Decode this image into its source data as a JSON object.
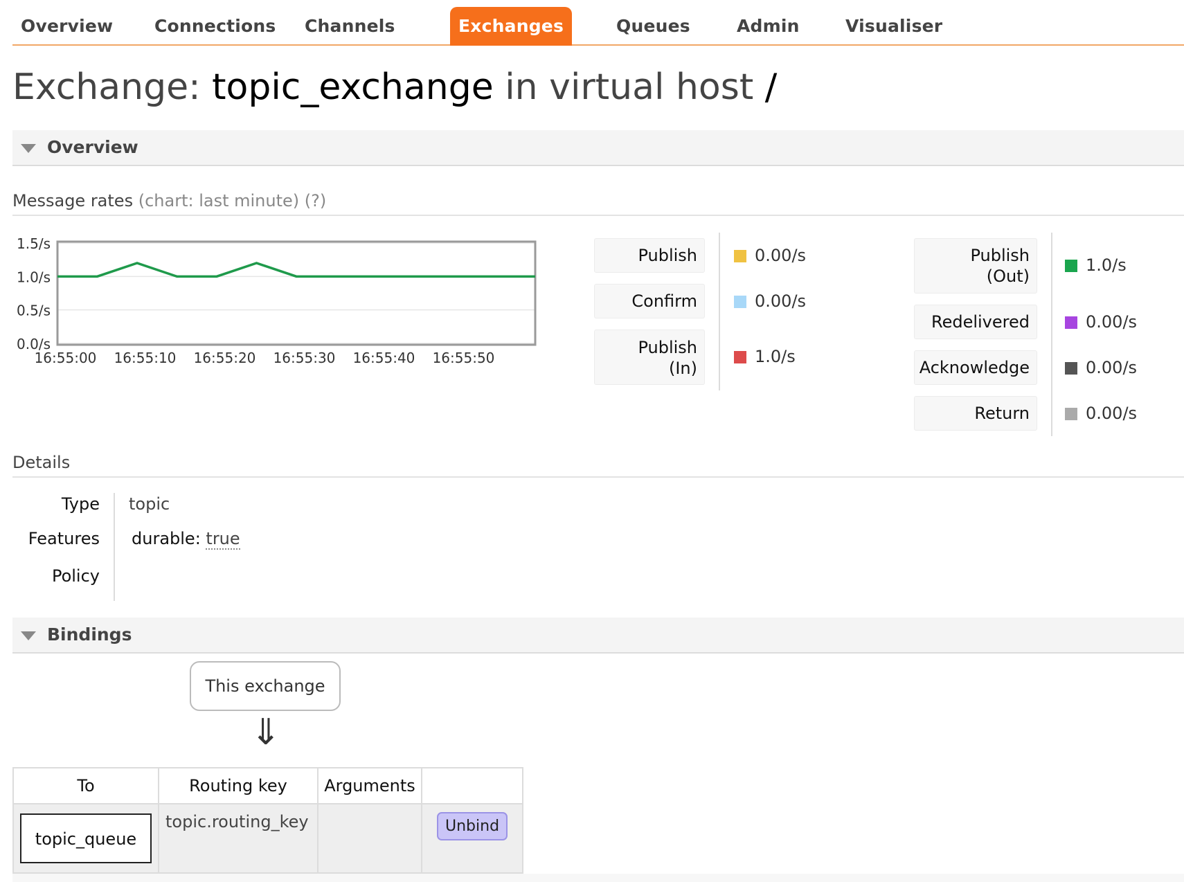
{
  "nav": {
    "items": [
      {
        "label": "Overview",
        "active": false
      },
      {
        "label": "Connections",
        "active": false
      },
      {
        "label": "Channels",
        "active": false
      },
      {
        "label": "Exchanges",
        "active": true
      },
      {
        "label": "Queues",
        "active": false
      },
      {
        "label": "Admin",
        "active": false
      },
      {
        "label": "Visualiser",
        "active": false
      }
    ]
  },
  "page": {
    "title_prefix": "Exchange: ",
    "exchange_name": "topic_exchange",
    "title_middle": " in virtual host ",
    "vhost": "/"
  },
  "overview": {
    "section_title": "Overview",
    "rates_heading": "Message rates",
    "rates_sub": "(chart: last minute) (?)"
  },
  "chart_data": {
    "type": "line",
    "title": "",
    "xlabel": "",
    "ylabel": "",
    "x_ticks": [
      "16:55:00",
      "16:55:10",
      "16:55:20",
      "16:55:30",
      "16:55:40",
      "16:55:50"
    ],
    "y_ticks": [
      "1.5/s",
      "1.0/s",
      "0.5/s",
      "0.0/s"
    ],
    "ylim": [
      0,
      1.5
    ],
    "series": [
      {
        "color": "#1f9a4b",
        "x": [
          "16:54:59",
          "16:55:04",
          "16:55:09",
          "16:55:14",
          "16:55:19",
          "16:55:24",
          "16:55:29",
          "16:55:34",
          "16:55:39",
          "16:55:44",
          "16:55:49",
          "16:55:54",
          "16:55:59"
        ],
        "values": [
          1.0,
          1.0,
          1.2,
          1.0,
          1.0,
          1.2,
          1.0,
          1.0,
          1.0,
          1.0,
          1.0,
          1.0,
          1.0
        ]
      }
    ],
    "grid": true
  },
  "rates_left": [
    {
      "label": "Publish",
      "value": "0.00/s",
      "color": "#f0c242"
    },
    {
      "label": "Confirm",
      "value": "0.00/s",
      "color": "#a8d8f8"
    },
    {
      "label": "Publish (In)",
      "value": "1.0/s",
      "color": "#dd4b4b"
    }
  ],
  "rates_right": [
    {
      "label": "Publish (Out)",
      "value": "1.0/s",
      "color": "#1aa54e"
    },
    {
      "label": "Redelivered",
      "value": "0.00/s",
      "color": "#a745e0"
    },
    {
      "label": "Acknowledge",
      "value": "0.00/s",
      "color": "#555555"
    },
    {
      "label": "Return",
      "value": "0.00/s",
      "color": "#aaaaaa"
    }
  ],
  "details": {
    "heading": "Details",
    "type_key": "Type",
    "type_value": "topic",
    "features_key": "Features",
    "features_label": "durable: ",
    "features_value": "true",
    "policy_key": "Policy"
  },
  "bindings": {
    "section_title": "Bindings",
    "this_exchange": "This exchange",
    "arrow": "⇓",
    "columns": [
      "To",
      "Routing key",
      "Arguments",
      ""
    ],
    "rows": [
      {
        "to": "topic_queue",
        "routing_key": "topic.routing_key",
        "arguments": "",
        "action": "Unbind"
      }
    ]
  }
}
